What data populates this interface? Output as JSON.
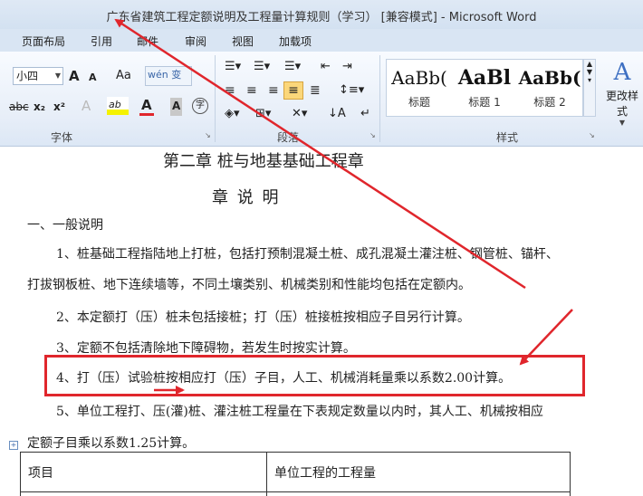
{
  "window": {
    "title": "广东省建筑工程定额说明及工程量计算规则（学习） [兼容模式] - Microsoft Word"
  },
  "tabs": [
    "页面布局",
    "引用",
    "邮件",
    "审阅",
    "视图",
    "加载项"
  ],
  "ribbon": {
    "font_size_value": "小四",
    "font_group_label": "字体",
    "paragraph_group_label": "段落",
    "styles_group_label": "样式",
    "font_buttons": {
      "grow": "A",
      "shrink": "A",
      "change_case": "Aa",
      "strike": "abc",
      "subscript": "x₂",
      "superscript": "x²",
      "font_color": "A",
      "char_shade": "A",
      "enclose": "字"
    },
    "styles": [
      {
        "sample": "AaBb(",
        "name": "标题"
      },
      {
        "sample": "AaBl",
        "name": "标题 1"
      },
      {
        "sample": "AaBb(",
        "name": "标题 2"
      }
    ],
    "change_styles_label": "更改样式"
  },
  "document": {
    "chapter_title": "第二章  桩与地基基础工程章",
    "section_title": "章    说    明",
    "subsection": "一、一般说明",
    "para1_line1": "1、桩基础工程指陆地上打桩，包括打预制混凝土桩、成孔混凝土灌注桩、钢管桩、锚杆、",
    "para1_line2": "打拔钢板桩、地下连续墙等，不同土壤类别、机械类别和性能均包括在定额内。",
    "para2": "2、本定额打（压）桩未包括接桩；打（压）桩接桩按相应子目另行计算。",
    "para3": "3、定额不包括清除地下障碍物，若发生时按实计算。",
    "para4": "4、打（压）试验桩按相应打（压）子目，人工、机械消耗量乘以系数2.00计算。",
    "para5_line1": "5、单位工程打、压(灌)桩、灌注桩工程量在下表规定数量以内时，其人工、机械按相应",
    "para5_line2": "定额子目乘以系数1.25计算。",
    "table_headers": [
      "项目",
      "单位工程的工程量"
    ]
  },
  "colors": {
    "annotation_red": "#e0262c",
    "ribbon_blue": "#d9e5f3"
  }
}
